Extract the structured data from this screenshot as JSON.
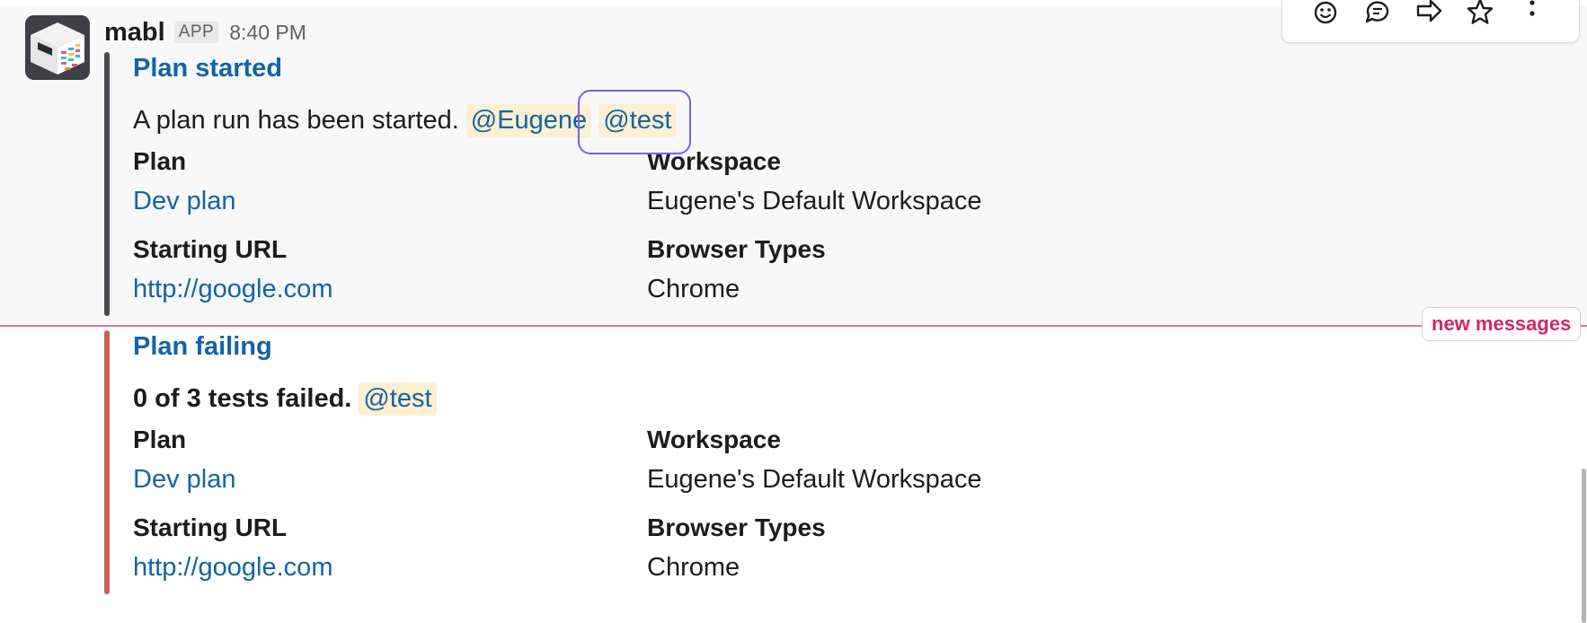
{
  "message": {
    "sender": "mabl",
    "badge": "APP",
    "time": "8:40 PM"
  },
  "toolbar": {
    "icons": [
      "emoji-reaction-icon",
      "reply-thread-icon",
      "share-icon",
      "star-icon",
      "more-actions-icon"
    ]
  },
  "attachments": [
    {
      "title": "Plan started",
      "text": "A plan run has been started.",
      "mentions": [
        "@Eugene",
        "@test"
      ],
      "bar_color": "#4a4a52",
      "fields": [
        {
          "label": "Plan",
          "value": "Dev plan"
        },
        {
          "label": "Workspace",
          "value": "Eugene's Default Workspace"
        },
        {
          "label": "Starting URL",
          "value": "http://google.com"
        },
        {
          "label": "Browser Types",
          "value": "Chrome"
        }
      ]
    },
    {
      "title": "Plan failing",
      "text": "0 of 3 tests failed.",
      "mentions": [
        "@test"
      ],
      "bar_color": "#d05c5c",
      "fields": [
        {
          "label": "Plan",
          "value": "Dev plan"
        },
        {
          "label": "Workspace",
          "value": "Eugene's Default Workspace"
        },
        {
          "label": "Starting URL",
          "value": "http://google.com"
        },
        {
          "label": "Browser Types",
          "value": "Chrome"
        }
      ]
    }
  ],
  "divider": {
    "label": "new messages"
  },
  "colors": {
    "link": "#1264a3",
    "mention_bg": "#fcefd2",
    "focus_ring": "#7c5cf0",
    "new_messages": "#d1295e"
  }
}
